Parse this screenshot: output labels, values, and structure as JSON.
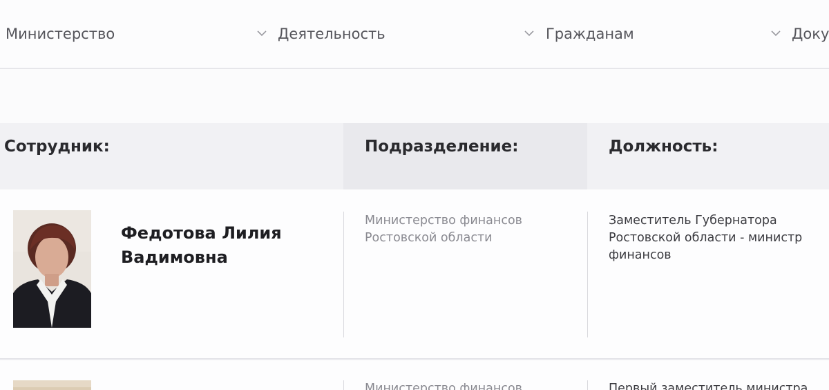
{
  "nav": {
    "items": [
      {
        "label": "Министерство"
      },
      {
        "label": "Деятельность"
      },
      {
        "label": "Гражданам"
      },
      {
        "label": "Доку"
      }
    ]
  },
  "table": {
    "headers": {
      "employee": "Сотрудник:",
      "department": "Подразделение:",
      "position": "Должность:"
    },
    "rows": [
      {
        "name_line1": "Федотова Лилия",
        "name_line2": "Вадимовна",
        "department_line1": "Министерство финансов",
        "department_line2": "Ростовской области",
        "position_line1": "Заместитель Губернатора",
        "position_line2": "Ростовской области - министр",
        "position_line3": "финансов"
      },
      {
        "department_line1": "Министерство финансов",
        "position_line1": "Первый заместитель министра"
      }
    ]
  },
  "icons": {
    "nav_dropdown": "chevron-down-icon"
  }
}
